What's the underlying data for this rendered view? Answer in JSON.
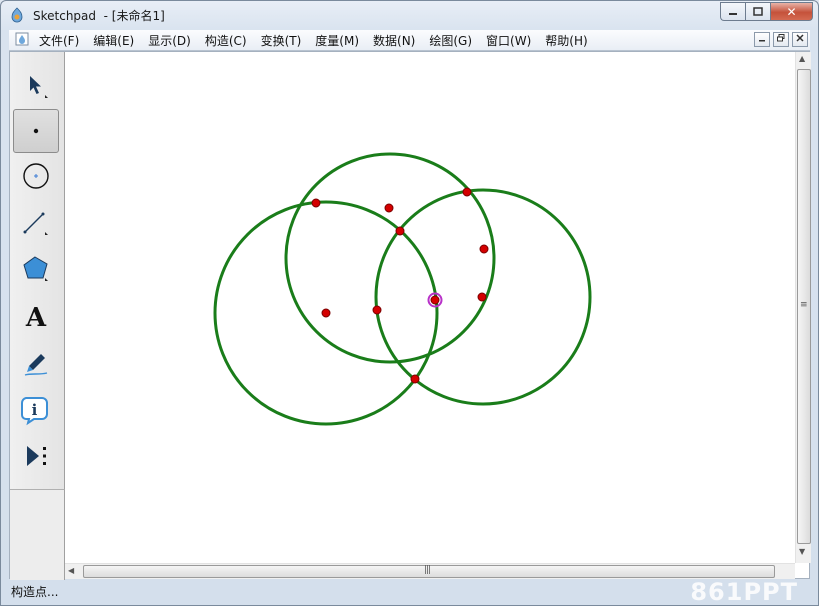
{
  "window": {
    "title": "Sketchpad  - [未命名1]",
    "close_glyph": "✕"
  },
  "menu": {
    "items": [
      "文件(F)",
      "编辑(E)",
      "显示(D)",
      "构造(C)",
      "变换(T)",
      "度量(M)",
      "数据(N)",
      "绘图(G)",
      "窗口(W)",
      "帮助(H)"
    ]
  },
  "toolbox": {
    "tools": [
      {
        "name": "select-arrow-tool-icon",
        "active": false
      },
      {
        "name": "point-tool-icon",
        "active": true
      },
      {
        "name": "compass-circle-tool-icon",
        "active": false
      },
      {
        "name": "straightedge-tool-icon",
        "active": false
      },
      {
        "name": "polygon-tool-icon",
        "active": false
      },
      {
        "name": "text-tool-icon",
        "active": false,
        "glyph": "A"
      },
      {
        "name": "marker-tool-icon",
        "active": false
      },
      {
        "name": "information-tool-icon",
        "active": false
      },
      {
        "name": "custom-tools-icon",
        "active": false
      }
    ]
  },
  "sketch": {
    "circle_color": "#1a7d1a",
    "point_color": "#d40000",
    "highlight_color": "#b832c9"
  },
  "status": {
    "text": "构造点..."
  },
  "watermark": {
    "text": "861PPT"
  },
  "colors": {
    "titlebar": "#dbe5f1",
    "close_button": "#c5523b"
  }
}
